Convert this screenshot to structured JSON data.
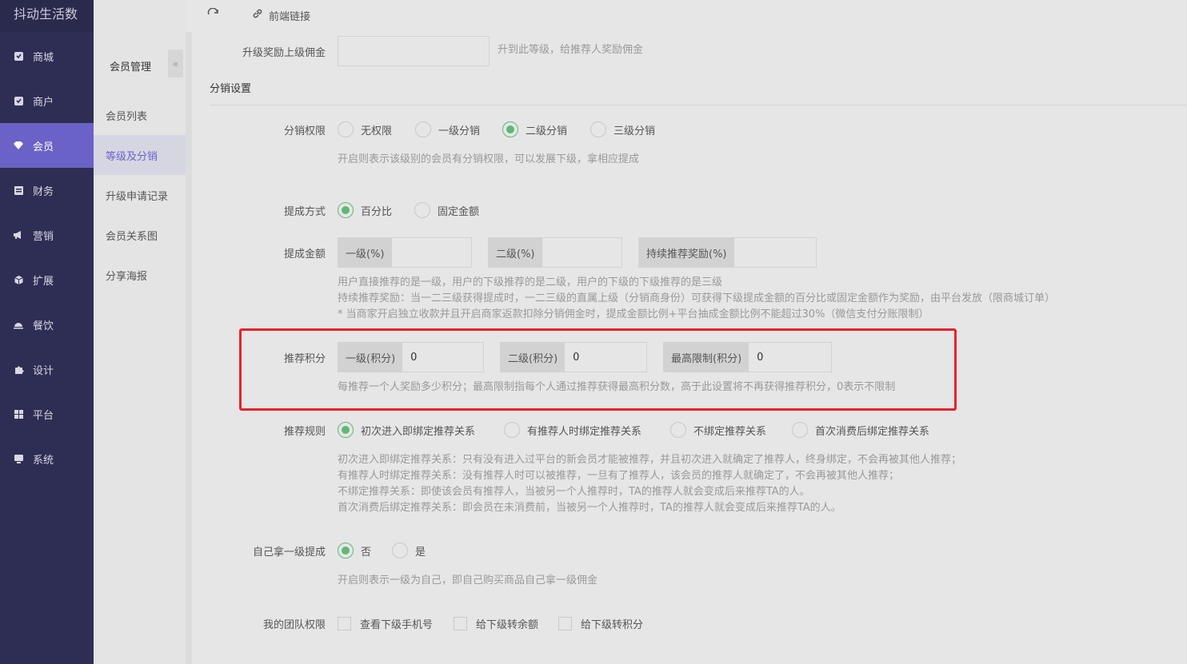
{
  "app": {
    "title": "抖动生活数"
  },
  "nav": {
    "items": [
      {
        "label": "商城",
        "icon": "shop-icon"
      },
      {
        "label": "商户",
        "icon": "merchant-icon"
      },
      {
        "label": "会员",
        "icon": "member-icon",
        "active": true
      },
      {
        "label": "财务",
        "icon": "finance-icon"
      },
      {
        "label": "营销",
        "icon": "megaphone-icon"
      },
      {
        "label": "扩展",
        "icon": "cube-icon"
      },
      {
        "label": "餐饮",
        "icon": "dining-icon"
      },
      {
        "label": "设计",
        "icon": "puzzle-icon"
      },
      {
        "label": "平台",
        "icon": "grid-icon"
      },
      {
        "label": "系统",
        "icon": "monitor-icon"
      }
    ]
  },
  "submenu": {
    "title": "会员管理",
    "collapse_glyph": "«",
    "items": [
      {
        "label": "会员列表"
      },
      {
        "label": "等级及分销",
        "active": true
      },
      {
        "label": "升级申请记录"
      },
      {
        "label": "会员关系图"
      },
      {
        "label": "分享海报"
      }
    ]
  },
  "toolbar": {
    "link_label": "前端链接"
  },
  "form": {
    "upgrade_commission": {
      "label": "升级奖励上级佣金",
      "value": "",
      "help": "升到此等级，给推荐人奖励佣金"
    },
    "section_title": "分销设置",
    "permission": {
      "label": "分销权限",
      "options": [
        "无权限",
        "一级分销",
        "二级分销",
        "三级分销"
      ],
      "selected": "二级分销",
      "help": "开启则表示该级别的会员有分销权限，可以发展下级，拿相应提成"
    },
    "method": {
      "label": "提成方式",
      "options": [
        "百分比",
        "固定金额"
      ],
      "selected": "百分比"
    },
    "amount": {
      "label": "提成金额",
      "fields": [
        {
          "prefix": "一级(%)",
          "value": ""
        },
        {
          "prefix": "二级(%)",
          "value": ""
        },
        {
          "prefix": "持续推荐奖励(%)",
          "value": ""
        }
      ],
      "help": [
        "用户直接推荐的是一级，用户的下级推荐的是二级，用户的下级的下级推荐的是三级",
        "持续推荐奖励：当一二三级获得提成时，一二三级的直属上级（分销商身份）可获得下级提成金额的百分比或固定金额作为奖励，由平台发放（限商城订单）",
        "* 当商家开启独立收款并且开启商家返款扣除分销佣金时，提成金额比例+平台抽成金额比例不能超过30%（微信支付分账限制）"
      ]
    },
    "points": {
      "label": "推荐积分",
      "fields": [
        {
          "prefix": "一级(积分)",
          "value": "0"
        },
        {
          "prefix": "二级(积分)",
          "value": "0"
        },
        {
          "prefix": "最高限制(积分)",
          "value": "0"
        }
      ],
      "help": "每推荐一个人奖励多少积分；最高限制指每个人通过推荐获得最高积分数，高于此设置将不再获得推荐积分，0表示不限制"
    },
    "rule": {
      "label": "推荐规则",
      "options": [
        "初次进入即绑定推荐关系",
        "有推荐人时绑定推荐关系",
        "不绑定推荐关系",
        "首次消费后绑定推荐关系"
      ],
      "selected": "初次进入即绑定推荐关系",
      "help": [
        "初次进入即绑定推荐关系：只有没有进入过平台的新会员才能被推荐，并且初次进入就确定了推荐人，终身绑定，不会再被其他人推荐；",
        "有推荐人时绑定推荐关系：没有推荐人时可以被推荐，一旦有了推荐人，该会员的推荐人就确定了，不会再被其他人推荐；",
        "不绑定推荐关系：即使该会员有推荐人，当被另一个人推荐时，TA的推荐人就会变成后来推荐TA的人。",
        "首次消费后绑定推荐关系：即会员在未消费前，当被另一个人推荐时，TA的推荐人就会变成后来推荐TA的人。"
      ]
    },
    "self_commission": {
      "label": "自己拿一级提成",
      "options": [
        "否",
        "是"
      ],
      "selected": "否",
      "help": "开启则表示一级为自己，即自己购买商品自己拿一级佣金"
    },
    "team": {
      "label": "我的团队权限",
      "options": [
        "查看下级手机号",
        "给下级转余额",
        "给下级转积分"
      ]
    }
  },
  "colors": {
    "sidebar": "#2e2e54",
    "active": "#6a62c7",
    "radio_on": "#5fb878",
    "highlight": "#e8212a"
  }
}
